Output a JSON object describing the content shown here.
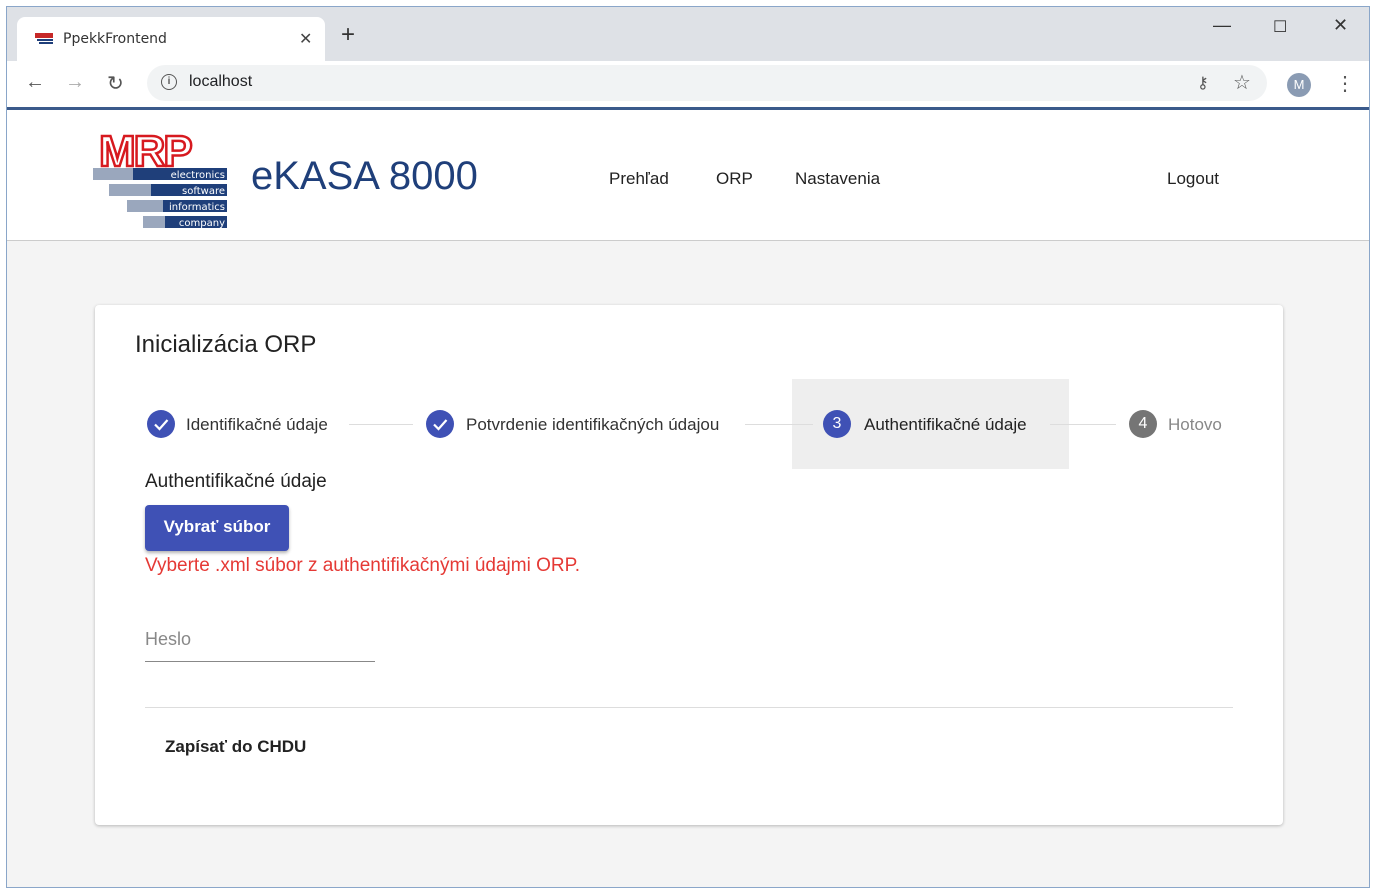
{
  "browser": {
    "tab_title": "PpekkFrontend",
    "url": "localhost",
    "avatar_initial": "M"
  },
  "header": {
    "brand": "eKASA 8000",
    "logo_lines": [
      "electronics",
      "software",
      "informatics",
      "company"
    ],
    "logo_word": "MRP",
    "nav": [
      "Prehľad",
      "ORP",
      "Nastavenia"
    ],
    "logout": "Logout"
  },
  "card": {
    "title": "Inicializácia ORP",
    "steps": [
      {
        "label": "Identifikačné údaje",
        "state": "done"
      },
      {
        "label": "Potvrdenie identifikačných údajou",
        "state": "done"
      },
      {
        "number": "3",
        "label": "Authentifikačné údaje",
        "state": "active"
      },
      {
        "number": "4",
        "label": "Hotovo",
        "state": "pending"
      }
    ],
    "section_label": "Authentifikačné údaje",
    "file_button": "Vybrať súbor",
    "error": "Vyberte .xml súbor z authentifikačnými údajmi ORP.",
    "password_placeholder": "Heslo",
    "submit": "Zapísať do CHDU"
  },
  "colors": {
    "primary": "#3f51b5",
    "error": "#e53935",
    "brand": "#1f3f7a",
    "logo_red": "#d7191f"
  }
}
